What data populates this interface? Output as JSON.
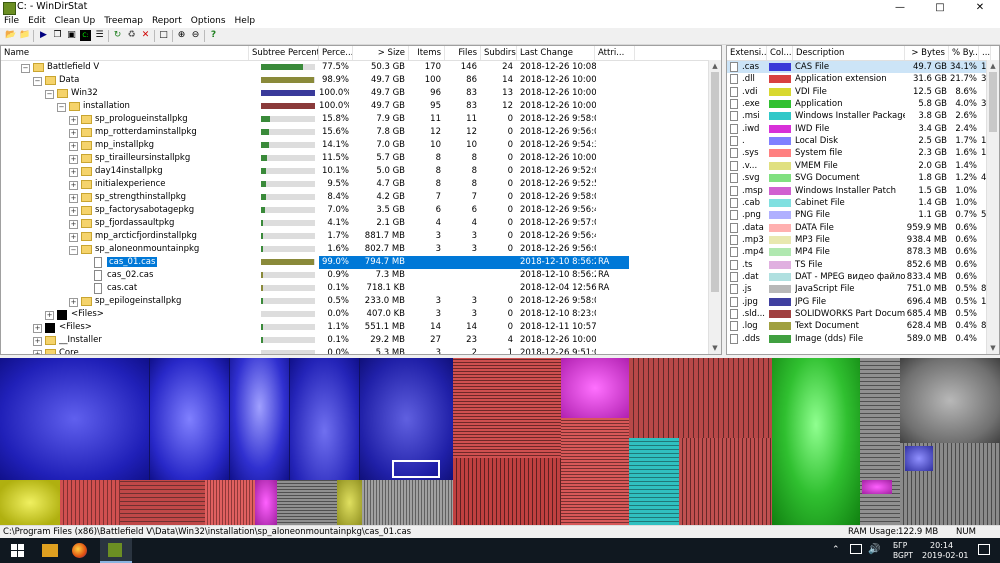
{
  "window": {
    "title": "C: - WinDirStat"
  },
  "menu": [
    "File",
    "Edit",
    "Clean Up",
    "Treemap",
    "Report",
    "Options",
    "Help"
  ],
  "tree": {
    "columns": [
      "Name",
      "Subtree Percent...",
      "Perce...",
      "> Size",
      "Items",
      "Files",
      "Subdirs",
      "Last Change",
      "Attri..."
    ],
    "rows": [
      {
        "name": "Battlefield V",
        "level": 2,
        "exp": "−",
        "kind": "folder",
        "bar": 0.775,
        "bar_color": "#3a8a3a",
        "pct": "77.5%",
        "size": "50.3 GB",
        "items": "170",
        "files": "146",
        "subdirs": "24",
        "last": "2018-12-26 10:08:...",
        "attr": ""
      },
      {
        "name": "Data",
        "level": 3,
        "exp": "−",
        "kind": "folder",
        "bar": 0.989,
        "bar_color": "#8a8a3a",
        "pct": "98.9%",
        "size": "49.7 GB",
        "items": "100",
        "files": "86",
        "subdirs": "14",
        "last": "2018-12-26 10:00:...",
        "attr": ""
      },
      {
        "name": "Win32",
        "level": 4,
        "exp": "−",
        "kind": "folder",
        "bar": 1.0,
        "bar_color": "#3a3a9a",
        "pct": "100.0%",
        "size": "49.7 GB",
        "items": "96",
        "files": "83",
        "subdirs": "13",
        "last": "2018-12-26 10:00:...",
        "attr": ""
      },
      {
        "name": "installation",
        "level": 5,
        "exp": "−",
        "kind": "folder",
        "bar": 1.0,
        "bar_color": "#8a3a3a",
        "pct": "100.0%",
        "size": "49.7 GB",
        "items": "95",
        "files": "83",
        "subdirs": "12",
        "last": "2018-12-26 10:00:...",
        "attr": ""
      },
      {
        "name": "sp_prologueinstallpkg",
        "level": 6,
        "exp": "+",
        "kind": "folder",
        "bar": 0.158,
        "bar_color": "#3a8a3a",
        "pct": "15.8%",
        "size": "7.9 GB",
        "items": "11",
        "files": "11",
        "subdirs": "0",
        "last": "2018-12-26 9:58:0...",
        "attr": ""
      },
      {
        "name": "mp_rotterdaminstallpkg",
        "level": 6,
        "exp": "+",
        "kind": "folder",
        "bar": 0.156,
        "bar_color": "#3a8a3a",
        "pct": "15.6%",
        "size": "7.8 GB",
        "items": "12",
        "files": "12",
        "subdirs": "0",
        "last": "2018-12-26 9:56:0...",
        "attr": ""
      },
      {
        "name": "mp_installpkg",
        "level": 6,
        "exp": "+",
        "kind": "folder",
        "bar": 0.141,
        "bar_color": "#3a8a3a",
        "pct": "14.1%",
        "size": "7.0 GB",
        "items": "10",
        "files": "10",
        "subdirs": "0",
        "last": "2018-12-26 9:54:3...",
        "attr": ""
      },
      {
        "name": "sp_tirailleursinstallpkg",
        "level": 6,
        "exp": "+",
        "kind": "folder",
        "bar": 0.115,
        "bar_color": "#3a8a3a",
        "pct": "11.5%",
        "size": "5.7 GB",
        "items": "8",
        "files": "8",
        "subdirs": "0",
        "last": "2018-12-26 10:00:...",
        "attr": ""
      },
      {
        "name": "day14installpkg",
        "level": 6,
        "exp": "+",
        "kind": "folder",
        "bar": 0.101,
        "bar_color": "#3a8a3a",
        "pct": "10.1%",
        "size": "5.0 GB",
        "items": "8",
        "files": "8",
        "subdirs": "0",
        "last": "2018-12-26 9:52:0...",
        "attr": ""
      },
      {
        "name": "initialexperience",
        "level": 6,
        "exp": "+",
        "kind": "folder",
        "bar": 0.095,
        "bar_color": "#3a8a3a",
        "pct": "9.5%",
        "size": "4.7 GB",
        "items": "8",
        "files": "8",
        "subdirs": "0",
        "last": "2018-12-26 9:52:5...",
        "attr": ""
      },
      {
        "name": "sp_strengthinstallpkg",
        "level": 6,
        "exp": "+",
        "kind": "folder",
        "bar": 0.084,
        "bar_color": "#3a8a3a",
        "pct": "8.4%",
        "size": "4.2 GB",
        "items": "7",
        "files": "7",
        "subdirs": "0",
        "last": "2018-12-26 9:58:0...",
        "attr": ""
      },
      {
        "name": "sp_factorysabotagepkg",
        "level": 6,
        "exp": "+",
        "kind": "folder",
        "bar": 0.07,
        "bar_color": "#3a8a3a",
        "pct": "7.0%",
        "size": "3.5 GB",
        "items": "6",
        "files": "6",
        "subdirs": "0",
        "last": "2018-12-26 9:56:4...",
        "attr": ""
      },
      {
        "name": "sp_fjordassaultpkg",
        "level": 6,
        "exp": "+",
        "kind": "folder",
        "bar": 0.041,
        "bar_color": "#3a8a3a",
        "pct": "4.1%",
        "size": "2.1 GB",
        "items": "4",
        "files": "4",
        "subdirs": "0",
        "last": "2018-12-26 9:57:0...",
        "attr": ""
      },
      {
        "name": "mp_arcticfjordinstallpkg",
        "level": 6,
        "exp": "+",
        "kind": "folder",
        "bar": 0.017,
        "bar_color": "#3a8a3a",
        "pct": "1.7%",
        "size": "881.7 MB",
        "items": "3",
        "files": "3",
        "subdirs": "0",
        "last": "2018-12-26 9:56:4...",
        "attr": ""
      },
      {
        "name": "sp_aloneonmountainpkg",
        "level": 6,
        "exp": "−",
        "kind": "folder",
        "bar": 0.016,
        "bar_color": "#3a8a3a",
        "pct": "1.6%",
        "size": "802.7 MB",
        "items": "3",
        "files": "3",
        "subdirs": "0",
        "last": "2018-12-26 9:56:0...",
        "attr": ""
      },
      {
        "name": "cas_01.cas",
        "level": 7,
        "exp": "",
        "kind": "file",
        "bar": 0.99,
        "bar_color": "#8a8a3a",
        "pct": "99.0%",
        "size": "794.7 MB",
        "items": "",
        "files": "",
        "subdirs": "",
        "last": "2018-12-10 8:56:2...",
        "attr": "RA",
        "selected": true
      },
      {
        "name": "cas_02.cas",
        "level": 7,
        "exp": "",
        "kind": "file",
        "bar": 0.009,
        "bar_color": "#8a8a3a",
        "pct": "0.9%",
        "size": "7.3 MB",
        "items": "",
        "files": "",
        "subdirs": "",
        "last": "2018-12-10 8:56:2...",
        "attr": "RA"
      },
      {
        "name": "cas.cat",
        "level": 7,
        "exp": "",
        "kind": "file",
        "bar": 0.001,
        "bar_color": "#8a8a3a",
        "pct": "0.1%",
        "size": "718.1 KB",
        "items": "",
        "files": "",
        "subdirs": "",
        "last": "2018-12-04 12:56:...",
        "attr": "RA"
      },
      {
        "name": "sp_epilogeinstallpkg",
        "level": 6,
        "exp": "+",
        "kind": "folder",
        "bar": 0.005,
        "bar_color": "#3a8a3a",
        "pct": "0.5%",
        "size": "233.0 MB",
        "items": "3",
        "files": "3",
        "subdirs": "0",
        "last": "2018-12-26 9:58:0...",
        "attr": ""
      },
      {
        "name": "<Files>",
        "level": 4,
        "exp": "+",
        "kind": "black",
        "bar": 0.0,
        "bar_color": "#3a8a3a",
        "pct": "0.0%",
        "size": "407.0 KB",
        "items": "3",
        "files": "3",
        "subdirs": "0",
        "last": "2018-12-10 8:23:0...",
        "attr": ""
      },
      {
        "name": "<Files>",
        "level": 3,
        "exp": "+",
        "kind": "black",
        "bar": 0.011,
        "bar_color": "#3a8a3a",
        "pct": "1.1%",
        "size": "551.1 MB",
        "items": "14",
        "files": "14",
        "subdirs": "0",
        "last": "2018-12-11 10:57:...",
        "attr": ""
      },
      {
        "name": "__Installer",
        "level": 3,
        "exp": "+",
        "kind": "folder",
        "bar": 0.001,
        "bar_color": "#3a8a3a",
        "pct": "0.1%",
        "size": "29.2 MB",
        "items": "27",
        "files": "23",
        "subdirs": "4",
        "last": "2018-12-26 10:00:...",
        "attr": ""
      },
      {
        "name": "Core",
        "level": 3,
        "exp": "+",
        "kind": "folder",
        "bar": 0.0,
        "bar_color": "#3a8a3a",
        "pct": "0.0%",
        "size": "5.3 MB",
        "items": "3",
        "files": "2",
        "subdirs": "1",
        "last": "2018-12-26 9:51:0...",
        "attr": ""
      }
    ]
  },
  "extensions": {
    "columns": [
      "Extensi...",
      "Col...",
      "Description",
      "> Bytes",
      "% By...",
      "..."
    ],
    "rows": [
      {
        "ext": ".cas",
        "color": "#3a3ad8",
        "desc": "CAS File",
        "bytes": "49.7 GB",
        "pct": "34.1%",
        "extra": "1",
        "selected": true
      },
      {
        "ext": ".dll",
        "color": "#d84040",
        "desc": "Application extension",
        "bytes": "31.6 GB",
        "pct": "21.7%",
        "extra": "35"
      },
      {
        "ext": ".vdi",
        "color": "#d8d830",
        "desc": "VDI File",
        "bytes": "12.5 GB",
        "pct": "8.6%",
        "extra": ""
      },
      {
        "ext": ".exe",
        "color": "#30c030",
        "desc": "Application",
        "bytes": "5.8 GB",
        "pct": "4.0%",
        "extra": "3"
      },
      {
        "ext": ".msi",
        "color": "#30c8c8",
        "desc": "Windows Installer Package",
        "bytes": "3.8 GB",
        "pct": "2.6%",
        "extra": ""
      },
      {
        "ext": ".iwd",
        "color": "#d830d8",
        "desc": "IWD File",
        "bytes": "3.4 GB",
        "pct": "2.4%",
        "extra": ""
      },
      {
        "ext": ".",
        "color": "#8080ff",
        "desc": "Local Disk",
        "bytes": "2.5 GB",
        "pct": "1.7%",
        "extra": "11"
      },
      {
        "ext": ".sys",
        "color": "#ff8080",
        "desc": "System file",
        "bytes": "2.3 GB",
        "pct": "1.6%",
        "extra": "1"
      },
      {
        "ext": ".v...",
        "color": "#e0e080",
        "desc": "VMEM File",
        "bytes": "2.0 GB",
        "pct": "1.4%",
        "extra": ""
      },
      {
        "ext": ".svg",
        "color": "#80e080",
        "desc": "SVG Document",
        "bytes": "1.8 GB",
        "pct": "1.2%",
        "extra": "4"
      },
      {
        "ext": ".msp",
        "color": "#d060d0",
        "desc": "Windows Installer Patch",
        "bytes": "1.5 GB",
        "pct": "1.0%",
        "extra": ""
      },
      {
        "ext": ".cab",
        "color": "#80e0e0",
        "desc": "Cabinet File",
        "bytes": "1.4 GB",
        "pct": "1.0%",
        "extra": ""
      },
      {
        "ext": ".png",
        "color": "#b0b0ff",
        "desc": "PNG File",
        "bytes": "1.1 GB",
        "pct": "0.7%",
        "extra": "55"
      },
      {
        "ext": ".data",
        "color": "#ffb0b0",
        "desc": "DATA File",
        "bytes": "959.9 MB",
        "pct": "0.6%",
        "extra": ""
      },
      {
        "ext": ".mp3",
        "color": "#e8e8b0",
        "desc": "MP3 File",
        "bytes": "938.4 MB",
        "pct": "0.6%",
        "extra": ""
      },
      {
        "ext": ".mp4",
        "color": "#b0e8b0",
        "desc": "MP4 File",
        "bytes": "878.3 MB",
        "pct": "0.6%",
        "extra": ""
      },
      {
        "ext": ".ts",
        "color": "#e0b0e0",
        "desc": "TS File",
        "bytes": "852.6 MB",
        "pct": "0.6%",
        "extra": ""
      },
      {
        "ext": ".dat",
        "color": "#b0e0e0",
        "desc": "DAT - MPEG видео файлове",
        "bytes": "833.4 MB",
        "pct": "0.6%",
        "extra": ""
      },
      {
        "ext": ".js",
        "color": "#b8b8b8",
        "desc": "JavaScript File",
        "bytes": "751.0 MB",
        "pct": "0.5%",
        "extra": "8"
      },
      {
        "ext": ".jpg",
        "color": "#4040a0",
        "desc": "JPG File",
        "bytes": "696.4 MB",
        "pct": "0.5%",
        "extra": "1"
      },
      {
        "ext": ".sld...",
        "color": "#a04040",
        "desc": "SOLIDWORKS Part Document",
        "bytes": "685.4 MB",
        "pct": "0.5%",
        "extra": ""
      },
      {
        "ext": ".log",
        "color": "#a0a040",
        "desc": "Text Document",
        "bytes": "628.4 MB",
        "pct": "0.4%",
        "extra": "8"
      },
      {
        "ext": ".dds",
        "color": "#40a040",
        "desc": "Image (dds) File",
        "bytes": "589.0 MB",
        "pct": "0.4%",
        "extra": ""
      }
    ]
  },
  "status": {
    "path": "C:\\Program Files (x86)\\Battlefield V\\Data\\Win32\\installation\\sp_aloneonmountainpkg\\cas_01.cas",
    "ram_label": "RAM Usage:",
    "ram_value": "122.9 MB",
    "num": "NUM"
  },
  "taskbar": {
    "lang1": "БГР",
    "lang2": "BGPT",
    "time": "20:14",
    "date": "2019-02-01"
  }
}
